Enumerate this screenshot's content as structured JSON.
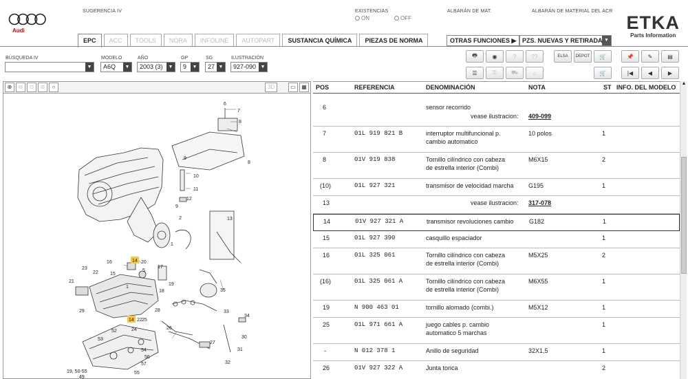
{
  "header": {
    "brand": "Audi",
    "sugerencia_label": "SUGERENCIA IV",
    "existencias_label": "EXISTENCIAS",
    "existencias_on": "ON",
    "existencias_off": "OFF",
    "albaran_mat": "ALBARÁN DE MAT.",
    "albaran_acr": "ALBARÁN DE MATERIAL DEL ACR",
    "etka_title": "ETKA",
    "etka_sub": "Parts Information"
  },
  "tabs": [
    {
      "label": "EPC",
      "state": "active"
    },
    {
      "label": "ACC",
      "state": "disabled"
    },
    {
      "label": "TOOLS",
      "state": "disabled"
    },
    {
      "label": "NORA",
      "state": "disabled"
    },
    {
      "label": "INFOLINE",
      "state": "disabled"
    },
    {
      "label": "AUTOPART",
      "state": "disabled"
    },
    {
      "label": "SUSTANCIA QUÍMICA",
      "state": "enabled"
    },
    {
      "label": "PIEZAS DE NORMA",
      "state": "enabled"
    }
  ],
  "otras_funciones": "OTRAS FUNCIONES ▶",
  "pzs_select": "PZS. NUEVAS Y RETIRADA",
  "filters": {
    "busqueda_label": "BÚSQUEDA IV",
    "busqueda_value": "",
    "modelo_label": "MODELO",
    "modelo_value": "A6Q",
    "ano_label": "AÑO",
    "ano_value": "2003 (3)",
    "gp_label": "GP",
    "gp_value": "9",
    "sg_label": "SG",
    "sg_value": "27",
    "ilustracion_label": "ILUSTRACIÓN",
    "ilustracion_value": "927-090"
  },
  "toolbar_icons": {
    "row1": [
      "printer-icon",
      "disk-icon",
      "question-icon",
      "elsa-icon",
      "depot-icon",
      "cart-icon",
      "pin-icon",
      "edit-icon",
      "doc-next-icon"
    ],
    "row2": [
      "list-icon",
      "key-icon",
      "car-icon",
      "shop-icon",
      "basket-icon",
      "first-icon",
      "prev-icon",
      "next-icon"
    ],
    "elsa": "ELSA",
    "depot": "DEPOT"
  },
  "viewer": {
    "btn_3d": "3D"
  },
  "table": {
    "headers": {
      "pos": "POS",
      "ref": "REFERENCIA",
      "denom": "DENOMINACIÓN",
      "nota": "NOTA",
      "st": "ST",
      "info": "INFO. DEL MODELO"
    },
    "rows": [
      {
        "pos": "6",
        "ref": "",
        "denom": "sensor recorrido",
        "nota": "",
        "st": "",
        "sub_label": "vease ilustracion:",
        "sub_link": "409-099"
      },
      {
        "pos": "7",
        "ref": "01L 919 821 B",
        "denom": "interruptor multifuncional p.",
        "denom2": "cambio automatico",
        "nota": "10 polos",
        "st": "1"
      },
      {
        "pos": "8",
        "ref": "01V 919 838",
        "denom": "Tornillo cilíndrico con cabeza",
        "denom2": "de estrella interior (Combi)",
        "nota": "M6X15",
        "st": "2"
      },
      {
        "pos": "(10)",
        "ref": "01L 927 321",
        "denom": "transmisor de velocidad marcha",
        "nota": "G195",
        "st": "1"
      },
      {
        "pos": "13",
        "ref": "",
        "denom": "",
        "nota": "",
        "st": "",
        "sub_label": "vease ilustracion:",
        "sub_link": "317-078"
      },
      {
        "pos": "14",
        "ref": "01V 927 321 A",
        "denom": "transmisor revoluciones cambio",
        "nota": "G182",
        "st": "1",
        "selected": true
      },
      {
        "pos": "15",
        "ref": "01L 927 390",
        "denom": "casquillo espaciador",
        "nota": "",
        "st": "1"
      },
      {
        "pos": "16",
        "ref": "01L 325 061",
        "denom": "Tornillo cilíndrico con cabeza",
        "denom2": "de estrella interior (Combi)",
        "nota": "M5X25",
        "st": "2"
      },
      {
        "pos": "(16)",
        "ref": "01L 325 061 A",
        "denom": "Tornillo cilíndrico con cabeza",
        "denom2": "de estrella interior (Combi)",
        "nota": "M6X55",
        "st": "1"
      },
      {
        "pos": "19",
        "ref": "N   900 463 01",
        "denom": "tornillo alomado (combi.)",
        "nota": "M5X12",
        "st": "1"
      },
      {
        "pos": "25",
        "ref": "01L 971 661 A",
        "denom": "juego cables p. cambio",
        "denom2": "automatico 5 marchas",
        "nota": "",
        "st": "1"
      },
      {
        "pos": "-",
        "ref": "N   012 378 1",
        "denom": "Anillo de seguridad",
        "nota": "32X1,5",
        "st": "1"
      },
      {
        "pos": "26",
        "ref": "01V 927 322 A",
        "denom": "Junta torica",
        "nota": "",
        "st": "2"
      }
    ]
  },
  "diagram_labels": [
    "6",
    "7",
    "8",
    "10",
    "11",
    "12",
    "9",
    "8",
    "9",
    "2",
    "13",
    "14",
    "1",
    "16",
    "15",
    "22",
    "23",
    "21",
    "20",
    "17",
    "19",
    "18",
    "35",
    "33",
    "34",
    "14",
    "22",
    "25",
    "24",
    "26",
    "30",
    "29",
    "28",
    "27",
    "31",
    "32",
    "52",
    "53",
    "54",
    "55",
    "57",
    "56",
    "19, 50-55",
    "49",
    "1",
    "5"
  ],
  "colors": {
    "callout": "#f5c842",
    "audi_red": "#cc0000"
  }
}
